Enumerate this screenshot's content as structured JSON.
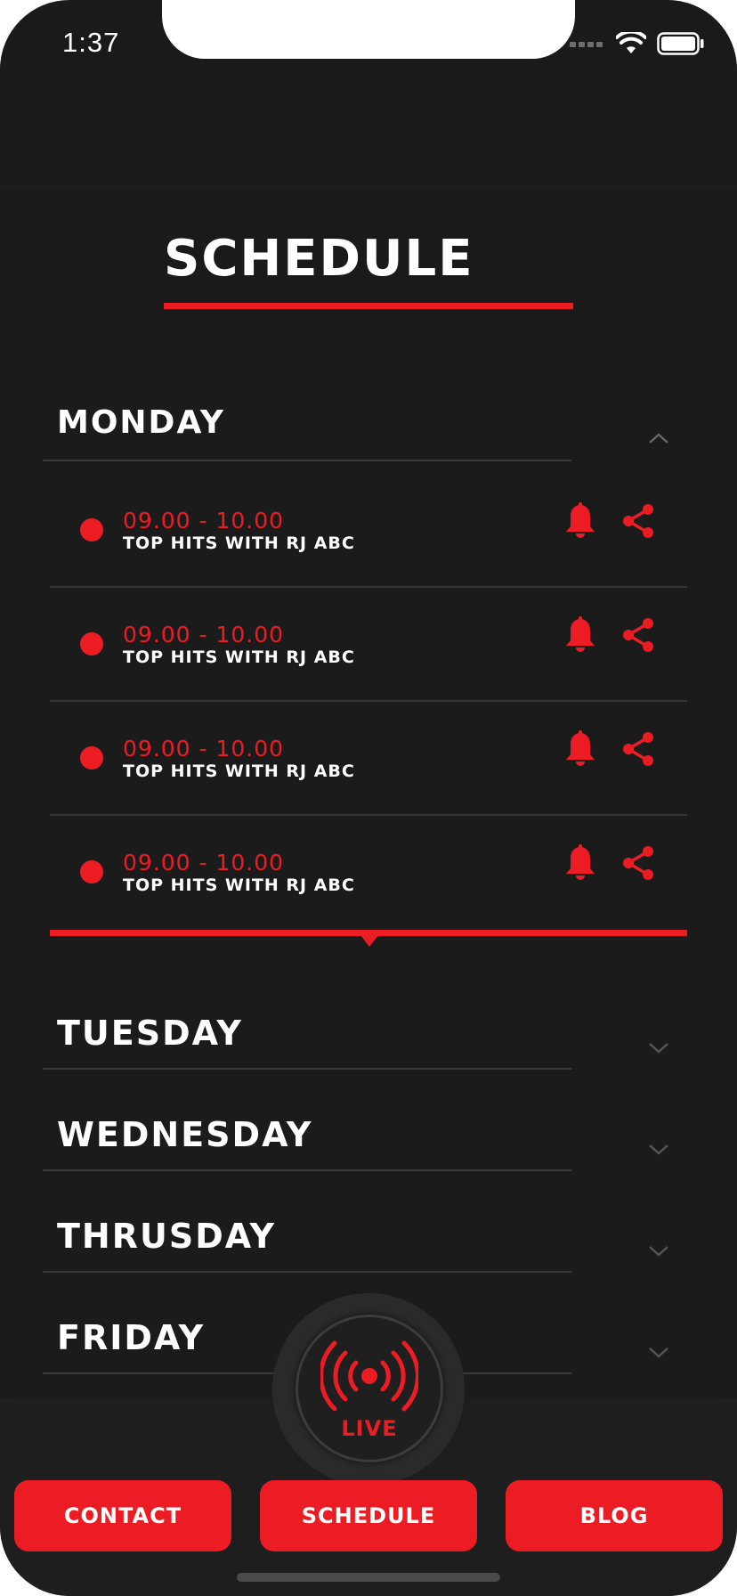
{
  "status_bar": {
    "time": "1:37"
  },
  "page": {
    "title": "SCHEDULE"
  },
  "days": [
    {
      "name": "MONDAY",
      "expanded": true
    },
    {
      "name": "TUESDAY",
      "expanded": false
    },
    {
      "name": "WEDNESDAY",
      "expanded": false
    },
    {
      "name": "THRUSDAY",
      "expanded": false
    },
    {
      "name": "FRIDAY",
      "expanded": false
    }
  ],
  "monday_items": [
    {
      "time": "09.00 - 10.00",
      "show": "TOP HITS WITH RJ ABC"
    },
    {
      "time": "09.00 - 10.00",
      "show": "TOP HITS WITH RJ ABC"
    },
    {
      "time": "09.00 - 10.00",
      "show": "TOP HITS WITH RJ ABC"
    },
    {
      "time": "09.00 - 10.00",
      "show": "TOP HITS WITH RJ ABC"
    }
  ],
  "live": {
    "label": "LIVE"
  },
  "nav": {
    "contact": "CONTACT",
    "schedule": "SCHEDULE",
    "blog": "BLOG"
  },
  "colors": {
    "accent": "#ec1c24",
    "background": "#1a1a1b",
    "text": "#ffffff"
  },
  "icons": [
    "bell-icon",
    "share-icon",
    "broadcast-icon",
    "chevron-up-icon",
    "chevron-down-icon",
    "wifi-icon",
    "battery-icon",
    "signal-icon"
  ]
}
